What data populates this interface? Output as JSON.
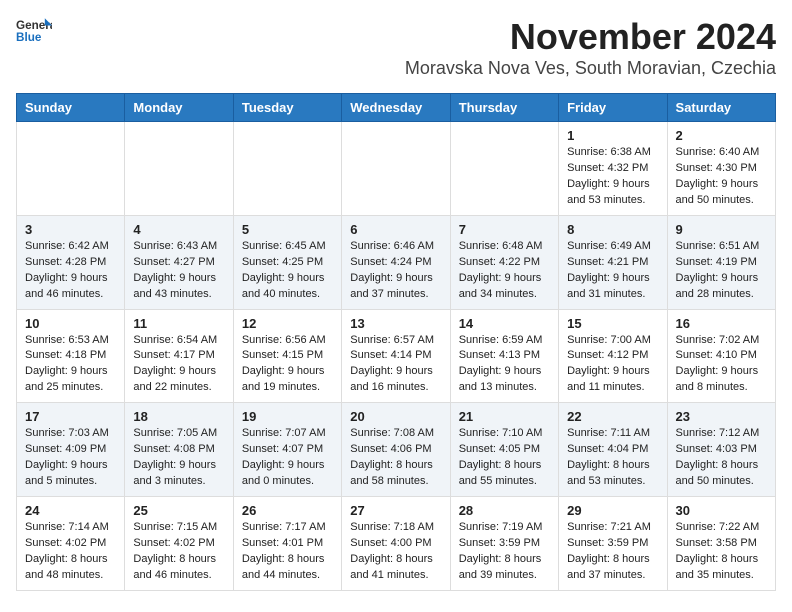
{
  "logo": {
    "general": "General",
    "blue": "Blue"
  },
  "title": "November 2024",
  "location": "Moravska Nova Ves, South Moravian, Czechia",
  "days_of_week": [
    "Sunday",
    "Monday",
    "Tuesday",
    "Wednesday",
    "Thursday",
    "Friday",
    "Saturday"
  ],
  "weeks": [
    [
      {
        "day": "",
        "info": ""
      },
      {
        "day": "",
        "info": ""
      },
      {
        "day": "",
        "info": ""
      },
      {
        "day": "",
        "info": ""
      },
      {
        "day": "",
        "info": ""
      },
      {
        "day": "1",
        "info": "Sunrise: 6:38 AM\nSunset: 4:32 PM\nDaylight: 9 hours and 53 minutes."
      },
      {
        "day": "2",
        "info": "Sunrise: 6:40 AM\nSunset: 4:30 PM\nDaylight: 9 hours and 50 minutes."
      }
    ],
    [
      {
        "day": "3",
        "info": "Sunrise: 6:42 AM\nSunset: 4:28 PM\nDaylight: 9 hours and 46 minutes."
      },
      {
        "day": "4",
        "info": "Sunrise: 6:43 AM\nSunset: 4:27 PM\nDaylight: 9 hours and 43 minutes."
      },
      {
        "day": "5",
        "info": "Sunrise: 6:45 AM\nSunset: 4:25 PM\nDaylight: 9 hours and 40 minutes."
      },
      {
        "day": "6",
        "info": "Sunrise: 6:46 AM\nSunset: 4:24 PM\nDaylight: 9 hours and 37 minutes."
      },
      {
        "day": "7",
        "info": "Sunrise: 6:48 AM\nSunset: 4:22 PM\nDaylight: 9 hours and 34 minutes."
      },
      {
        "day": "8",
        "info": "Sunrise: 6:49 AM\nSunset: 4:21 PM\nDaylight: 9 hours and 31 minutes."
      },
      {
        "day": "9",
        "info": "Sunrise: 6:51 AM\nSunset: 4:19 PM\nDaylight: 9 hours and 28 minutes."
      }
    ],
    [
      {
        "day": "10",
        "info": "Sunrise: 6:53 AM\nSunset: 4:18 PM\nDaylight: 9 hours and 25 minutes."
      },
      {
        "day": "11",
        "info": "Sunrise: 6:54 AM\nSunset: 4:17 PM\nDaylight: 9 hours and 22 minutes."
      },
      {
        "day": "12",
        "info": "Sunrise: 6:56 AM\nSunset: 4:15 PM\nDaylight: 9 hours and 19 minutes."
      },
      {
        "day": "13",
        "info": "Sunrise: 6:57 AM\nSunset: 4:14 PM\nDaylight: 9 hours and 16 minutes."
      },
      {
        "day": "14",
        "info": "Sunrise: 6:59 AM\nSunset: 4:13 PM\nDaylight: 9 hours and 13 minutes."
      },
      {
        "day": "15",
        "info": "Sunrise: 7:00 AM\nSunset: 4:12 PM\nDaylight: 9 hours and 11 minutes."
      },
      {
        "day": "16",
        "info": "Sunrise: 7:02 AM\nSunset: 4:10 PM\nDaylight: 9 hours and 8 minutes."
      }
    ],
    [
      {
        "day": "17",
        "info": "Sunrise: 7:03 AM\nSunset: 4:09 PM\nDaylight: 9 hours and 5 minutes."
      },
      {
        "day": "18",
        "info": "Sunrise: 7:05 AM\nSunset: 4:08 PM\nDaylight: 9 hours and 3 minutes."
      },
      {
        "day": "19",
        "info": "Sunrise: 7:07 AM\nSunset: 4:07 PM\nDaylight: 9 hours and 0 minutes."
      },
      {
        "day": "20",
        "info": "Sunrise: 7:08 AM\nSunset: 4:06 PM\nDaylight: 8 hours and 58 minutes."
      },
      {
        "day": "21",
        "info": "Sunrise: 7:10 AM\nSunset: 4:05 PM\nDaylight: 8 hours and 55 minutes."
      },
      {
        "day": "22",
        "info": "Sunrise: 7:11 AM\nSunset: 4:04 PM\nDaylight: 8 hours and 53 minutes."
      },
      {
        "day": "23",
        "info": "Sunrise: 7:12 AM\nSunset: 4:03 PM\nDaylight: 8 hours and 50 minutes."
      }
    ],
    [
      {
        "day": "24",
        "info": "Sunrise: 7:14 AM\nSunset: 4:02 PM\nDaylight: 8 hours and 48 minutes."
      },
      {
        "day": "25",
        "info": "Sunrise: 7:15 AM\nSunset: 4:02 PM\nDaylight: 8 hours and 46 minutes."
      },
      {
        "day": "26",
        "info": "Sunrise: 7:17 AM\nSunset: 4:01 PM\nDaylight: 8 hours and 44 minutes."
      },
      {
        "day": "27",
        "info": "Sunrise: 7:18 AM\nSunset: 4:00 PM\nDaylight: 8 hours and 41 minutes."
      },
      {
        "day": "28",
        "info": "Sunrise: 7:19 AM\nSunset: 3:59 PM\nDaylight: 8 hours and 39 minutes."
      },
      {
        "day": "29",
        "info": "Sunrise: 7:21 AM\nSunset: 3:59 PM\nDaylight: 8 hours and 37 minutes."
      },
      {
        "day": "30",
        "info": "Sunrise: 7:22 AM\nSunset: 3:58 PM\nDaylight: 8 hours and 35 minutes."
      }
    ]
  ]
}
